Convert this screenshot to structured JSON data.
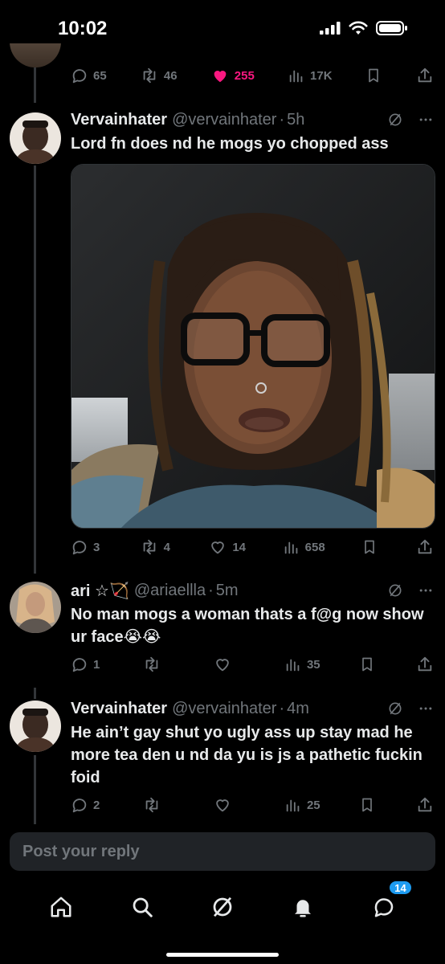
{
  "status_bar": {
    "time": "10:02"
  },
  "prev_tweet_actions": {
    "replies": "65",
    "reposts": "46",
    "likes": "255",
    "views": "17K"
  },
  "tweets": [
    {
      "name": "Vervainhater",
      "handle": "@vervainhater",
      "time": "5h",
      "text": "Lord fn does nd he mogs yo chopped ass",
      "actions": {
        "replies": "3",
        "reposts": "4",
        "likes": "14",
        "views": "658"
      }
    },
    {
      "name": "ari ☆🏹",
      "handle": "@ariaellla",
      "time": "5m",
      "text": "No man mogs a woman thats a f@g now show ur face😭😭",
      "actions": {
        "replies": "1",
        "reposts": "",
        "likes": "",
        "views": "35"
      }
    },
    {
      "name": "Vervainhater",
      "handle": "@vervainhater",
      "time": "4m",
      "text": "He ain’t gay shut yo ugly ass up stay mad he more tea den u nd da yu is js a pathetic fuckin foid",
      "actions": {
        "replies": "2",
        "reposts": "",
        "likes": "",
        "views": "25"
      }
    }
  ],
  "reply_bar": {
    "placeholder": "Post your reply"
  },
  "tab_bar": {
    "messages_badge": "14"
  },
  "colors": {
    "background": "#000000",
    "like_active": "#f91880",
    "muted": "#71767b",
    "badge": "#1d9bf0"
  }
}
